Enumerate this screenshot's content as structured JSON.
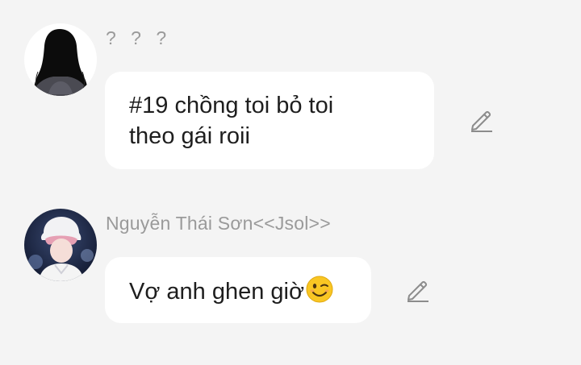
{
  "messages": [
    {
      "sender": "? ? ?",
      "text_lines": [
        "#19 chồng toi bỏ toi",
        "theo gái roii"
      ],
      "avatar_icon": "silhouette-avatar",
      "edit_icon": "pencil-icon"
    },
    {
      "sender": "Nguyễn Thái Sơn<<Jsol>>",
      "text": "Vợ anh ghen giờ",
      "emoji": "winking-face",
      "avatar_icon": "photo-avatar",
      "edit_icon": "pencil-icon"
    }
  ],
  "colors": {
    "background": "#f4f4f4",
    "bubble": "#ffffff",
    "sender_name": "#9a9a9a",
    "message_text": "#1e1e1e",
    "edit_icon": "#8c8c8c"
  }
}
